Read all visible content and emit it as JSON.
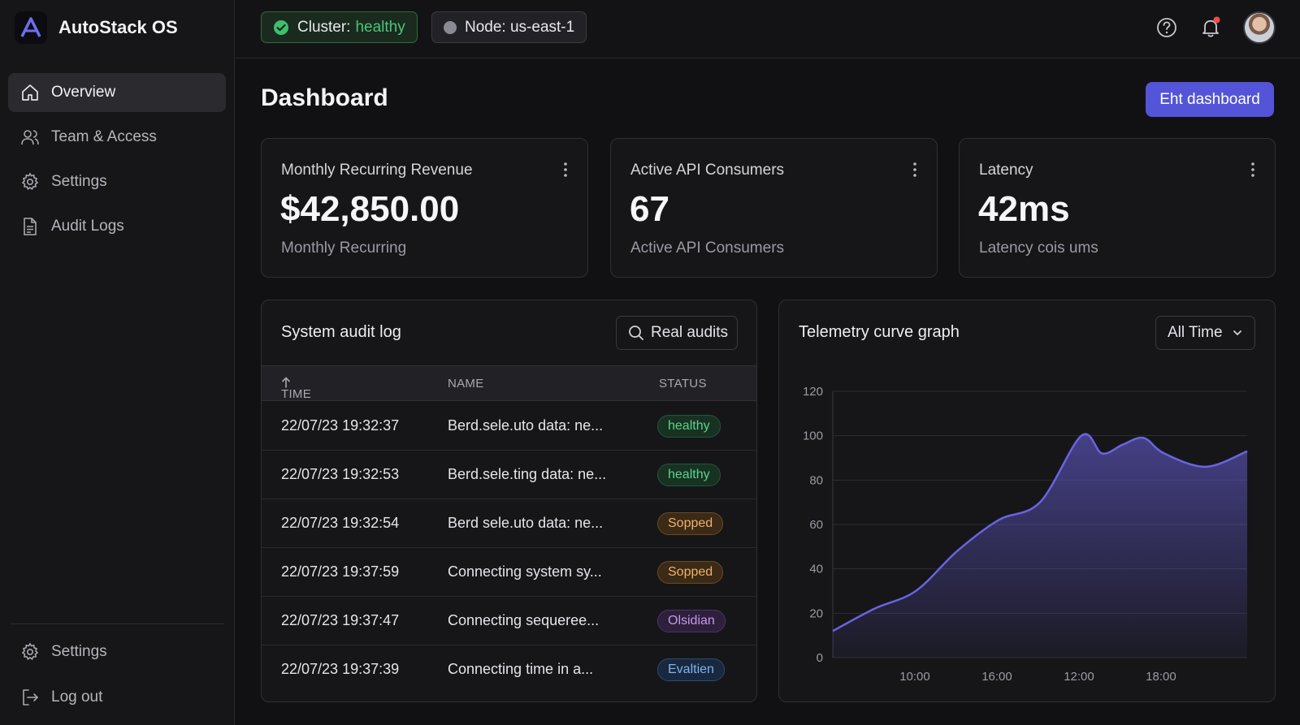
{
  "app": {
    "name": "AutoStack OS"
  },
  "sidebar": {
    "items": [
      {
        "label": "Overview",
        "icon": "home-icon",
        "active": true
      },
      {
        "label": "Team & Access",
        "icon": "users-icon"
      },
      {
        "label": "Settings",
        "icon": "gear-icon"
      },
      {
        "label": "Audit Logs",
        "icon": "document-icon"
      }
    ],
    "bottom": [
      {
        "label": "Settings",
        "icon": "gear-icon"
      },
      {
        "label": "Log out",
        "icon": "logout-icon"
      }
    ]
  },
  "topbar": {
    "cluster_label": "Cluster:",
    "cluster_status": "healthy",
    "node_label": "Node: us-east-1"
  },
  "main": {
    "title": "Dashboard",
    "edit_button": "Eht dashboard"
  },
  "kpis": [
    {
      "label": "Monthly Recurring Revenue",
      "value": "$42,850.00",
      "sub": "Monthly Recurring"
    },
    {
      "label": "Active API Consumers",
      "value": "67",
      "sub": "Active API Consumers"
    },
    {
      "label": "Latency",
      "value": "42ms",
      "sub": "Latency cois ums"
    }
  ],
  "audit": {
    "title": "System audit log",
    "search_value": "Real audits",
    "headers": {
      "time": "TIME",
      "name": "NAME",
      "status": "STATUS"
    },
    "rows": [
      {
        "time": "22/07/23 19:32:37",
        "name": "Berd.sele.uto data: ne...",
        "status": "healthy",
        "kind": "healthy"
      },
      {
        "time": "22/07/23 19:32:53",
        "name": "Berd.sele.ting data: ne...",
        "status": "healthy",
        "kind": "healthy"
      },
      {
        "time": "22/07/23 19:32:54",
        "name": "Berd sele.uto data: ne...",
        "status": "Sopped",
        "kind": "stopped"
      },
      {
        "time": "22/07/23 19:37:59",
        "name": "Connecting system sy...",
        "status": "Sopped",
        "kind": "stopped"
      },
      {
        "time": "22/07/23 19:37:47",
        "name": "Connecting sequeree...",
        "status": "Olsidian",
        "kind": "obs"
      },
      {
        "time": "22/07/23 19:37:39",
        "name": "Connecting time in a...",
        "status": "Evaltien",
        "kind": "eval"
      }
    ]
  },
  "telemetry": {
    "title": "Telemetry curve graph",
    "range": "All Time"
  },
  "chart_data": {
    "type": "area",
    "title": "Telemetry curve graph",
    "ylim": [
      0,
      120
    ],
    "yticks": [
      0,
      20,
      40,
      60,
      80,
      100,
      120
    ],
    "xticks": [
      "10:00",
      "16:00",
      "12:00",
      "18:00"
    ],
    "grid": true,
    "color": "#6b63e0",
    "x": [
      0,
      0.5,
      1,
      1.5,
      2,
      2.5,
      3,
      3.25,
      3.5,
      3.75,
      4,
      4.5,
      5
    ],
    "values": [
      12,
      22,
      30,
      48,
      62,
      70,
      100,
      92,
      96,
      99,
      92,
      86,
      93
    ]
  },
  "colors": {
    "accent": "#5454d8",
    "healthy": "#4cc47a"
  }
}
